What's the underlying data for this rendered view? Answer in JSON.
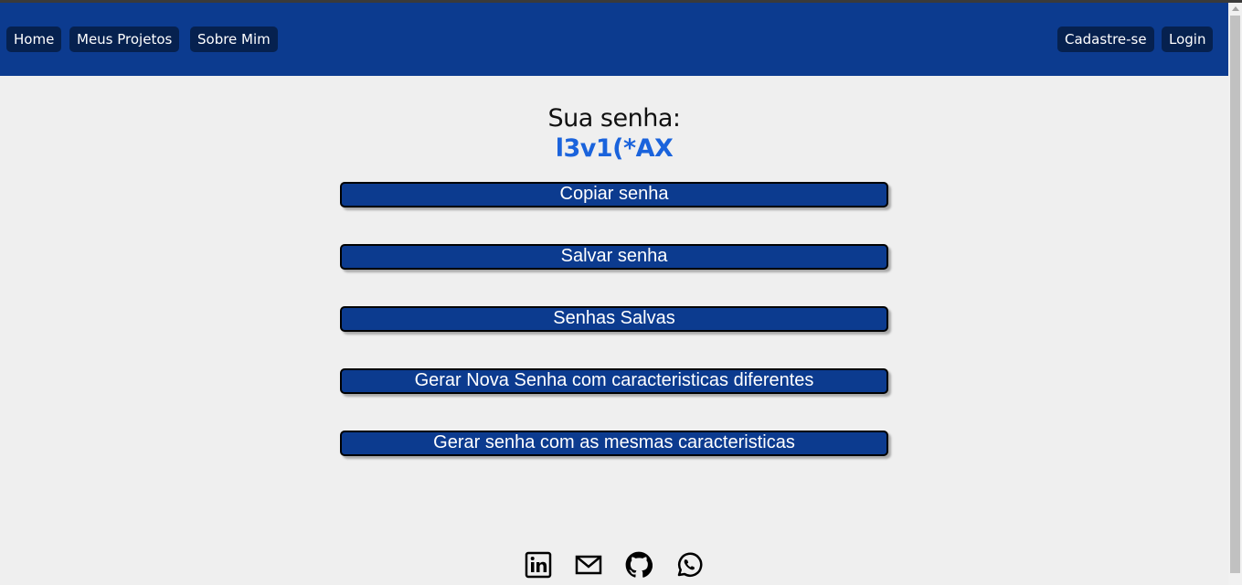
{
  "nav": {
    "left": [
      "Home",
      "Meus Projetos",
      "Sobre Mim"
    ],
    "right": [
      "Cadastre-se",
      "Login"
    ]
  },
  "main": {
    "title": "Sua senha:",
    "password": "l3v1(*AX",
    "buttons": [
      "Copiar senha",
      "Salvar senha",
      "Senhas Salvas",
      "Gerar Nova Senha com caracteristicas diferentes",
      "Gerar senha com as mesmas caracteristicas"
    ]
  },
  "footer": {
    "icons": [
      "linkedin-icon",
      "mail-icon",
      "github-icon",
      "whatsapp-icon"
    ]
  },
  "colors": {
    "header": "#0c3b8f",
    "nav_button": "#06214f",
    "password": "#1a63dc"
  }
}
